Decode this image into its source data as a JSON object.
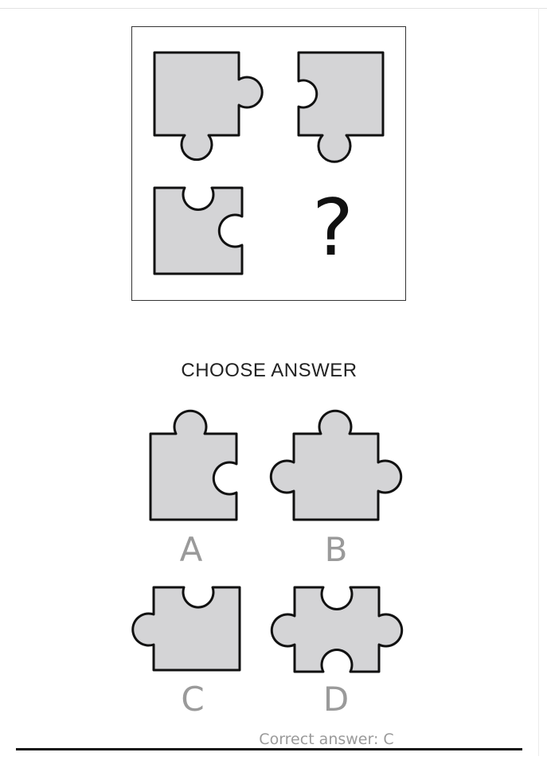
{
  "puzzle": {
    "missing_symbol": "?"
  },
  "answers": {
    "heading": "CHOOSE ANSWER",
    "options": [
      {
        "letter": "A"
      },
      {
        "letter": "B"
      },
      {
        "letter": "C"
      },
      {
        "letter": "D"
      }
    ]
  },
  "footer": {
    "correct_answer": "Correct answer: C"
  },
  "colors": {
    "piece_fill": "#d4d4d6",
    "piece_outline": "#111111",
    "letter_gray": "#9a9a9a"
  },
  "icons": [
    "puzzle-piece-icon"
  ]
}
